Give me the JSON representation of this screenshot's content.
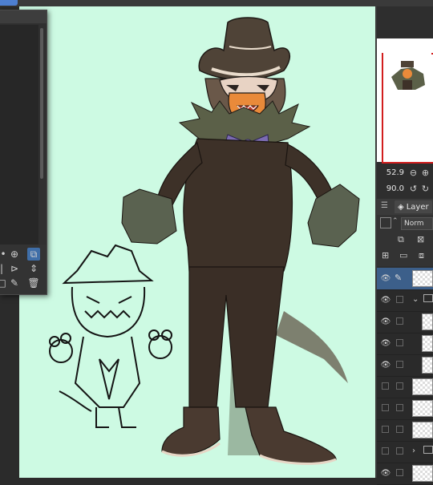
{
  "window": {
    "top_tab_label": ""
  },
  "navigator": {
    "zoom_value": "52.9",
    "rotation_value": "90.0"
  },
  "layer_panel": {
    "tab_label": "Layer",
    "blend_mode": "Norm",
    "layers": [
      {
        "kind": "raster",
        "selected": true,
        "visible": true
      },
      {
        "kind": "folder",
        "selected": false,
        "visible": true
      },
      {
        "kind": "raster",
        "selected": false,
        "visible": true
      },
      {
        "kind": "raster",
        "selected": false,
        "visible": true
      },
      {
        "kind": "raster",
        "selected": false,
        "visible": true
      },
      {
        "kind": "raster",
        "selected": false,
        "visible": false
      },
      {
        "kind": "raster",
        "selected": false,
        "visible": false
      },
      {
        "kind": "raster",
        "selected": false,
        "visible": false
      },
      {
        "kind": "folder",
        "selected": false,
        "visible": false
      },
      {
        "kind": "raster",
        "selected": false,
        "visible": false
      }
    ]
  },
  "colors": {
    "canvas_bg": "#cdfae3",
    "coat": "#3d3128",
    "fur": "#5b6048",
    "mask_face": "#e8d3c4",
    "muzzle": "#e98a3a",
    "bow": "#7b6bb1",
    "selection_blue": "#3c5f8a",
    "navigator_frame": "#d21e1e"
  },
  "icons": [
    "zoom-out-icon",
    "zoom-in-icon",
    "rotate-left-icon",
    "rotate-right-icon",
    "eye-icon",
    "pen-icon",
    "folder-icon",
    "new-layer-icon",
    "trash-icon",
    "mask-icon"
  ]
}
